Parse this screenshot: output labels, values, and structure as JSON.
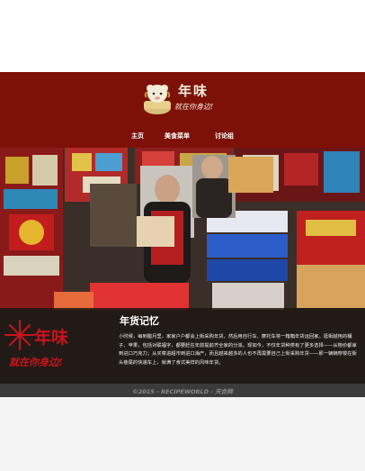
{
  "header": {
    "logo_title": "年味",
    "logo_slogan": "就在你身边!",
    "nav": [
      {
        "label": "主页"
      },
      {
        "label": "美食菜单"
      },
      {
        "label": "讨论组"
      }
    ]
  },
  "hero": {
    "title": "年货记忆",
    "text": "小时候，每到腊月里，家家户户都会上街采购年货，然后用自行车、摩托车将一箱箱年货运回家。逛街越用的桶子、苹果，包括对联福字，都要赶在年前提前齐全家的分派。现如今，不仅年货种类有了更多选择——从物价都拿到进口巧克力；从买菜进超市到进口海产，而且越来越多的人也不再需要自己上街采购年货——那一辆辆穿梭在街头巷尾的快递车上，就满了食式美样的风味年货。",
    "caption_logo_title": "年味",
    "caption_logo_slogan": "就在你身边!"
  },
  "footer": {
    "copyright": "©2015 - RECIPEWORLD - 天合网"
  },
  "colors": {
    "header": "#7d1108",
    "footer": "#3c3b3b",
    "caption_logo_red": "#c8141a"
  }
}
